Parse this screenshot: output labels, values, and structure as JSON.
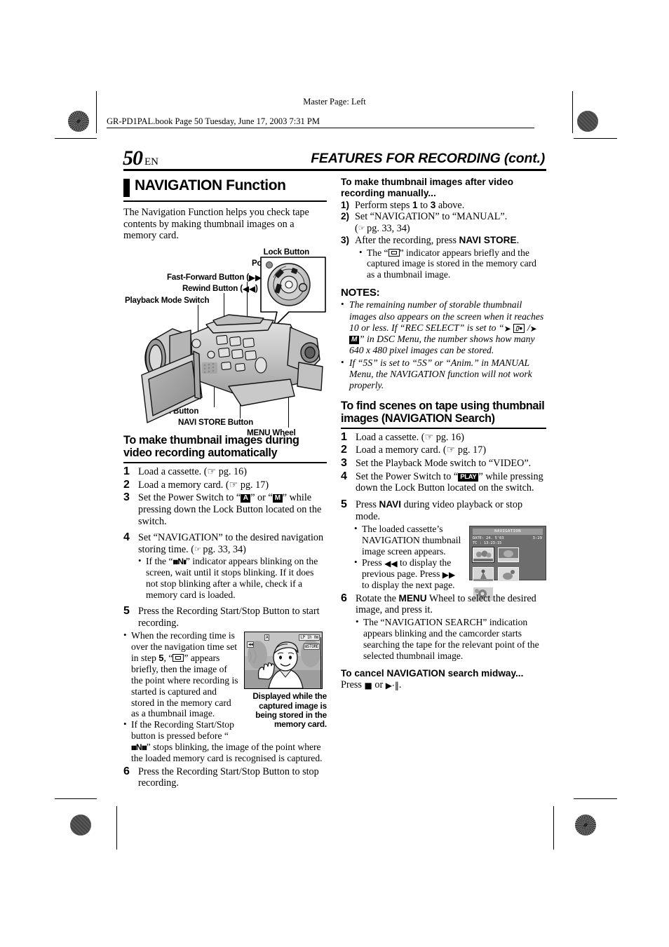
{
  "header": {
    "master_page": "Master Page: Left",
    "book_line": "GR-PD1PAL.book  Page 50  Tuesday, June 17, 2003  7:31 PM",
    "page_number": "50",
    "page_lang": "EN",
    "running_head": "FEATURES FOR RECORDING (cont.)"
  },
  "left": {
    "section_title": "NAVIGATION Function",
    "intro": "The Navigation Function helps you check tape contents by making thumbnail images on a memory card.",
    "figure_labels": {
      "lock_button": "Lock Button",
      "power_switch": "Power Switch",
      "fast_forward": "Fast-Forward Button (",
      "fast_forward_sym": "▶▶",
      "fast_forward_end": ")",
      "rewind": "Rewind Button (",
      "rewind_sym": "◀◀",
      "rewind_end": ")",
      "playback_mode": "Playback Mode Switch",
      "navi_button": "NAVI Button",
      "navi_store": "NAVI STORE Button",
      "menu_wheel": "MENU Wheel"
    },
    "subhead": "To make thumbnail images during video recording automatically",
    "steps": [
      {
        "n": "1",
        "text": "Load a cassette. (☞ pg. 16)"
      },
      {
        "n": "2",
        "text": "Load a memory card. (☞ pg. 17)"
      },
      {
        "n": "3",
        "text": "Set the Power Switch to “A” or “M” while pressing down the Lock Button located on the switch."
      },
      {
        "n": "4",
        "text": "Set “NAVIGATION” to the desired navigation storing time. (☞ pg. 33, 34)",
        "bullets": [
          "If the “NAVI” indicator appears blinking on the screen, wait until it stops blinking. If it does not stop blinking after a while, check if a memory card is loaded."
        ]
      },
      {
        "n": "5",
        "text": "Press the Recording Start/Stop Button to start recording.",
        "bullets": [
          "When the recording time is over the navigation time set in step 5, “⊞” appears briefly, then the image of the point where recording is started is captured and stored in the memory card as a thumbnail image.",
          "If the Recording Start/Stop button is pressed before “NAVI” stops blinking, the image of the point where the loaded memory card is recognised is captured."
        ]
      },
      {
        "n": "6",
        "text": "Press the Recording Start/Stop Button to stop recording."
      }
    ],
    "screen_caption": "Displayed while the captured image is being stored in the memory card.",
    "screen_osd": {
      "mode": "A",
      "battery": "◀◀",
      "rec_time": "1h 0m",
      "tape": "LP",
      "store": "STORE"
    }
  },
  "right": {
    "manual_head": "To make thumbnail images after video recording manually...",
    "manual_steps": [
      {
        "n": "1)",
        "text": "Perform steps 1 to 3 above."
      },
      {
        "n": "2)",
        "text": "Set “NAVIGATION” to “MANUAL”. (☞ pg. 33, 34)"
      },
      {
        "n": "3)",
        "text": "After the recording, press NAVI STORE.",
        "bullets": [
          "The “⊞” indicator appears briefly and the captured image is stored in the memory card as a thumbnail image."
        ]
      }
    ],
    "notes_head": "NOTES:",
    "notes": [
      "The remaining number of storable thumbnail images also appears on the screen when it reaches 10 or less. If “REC SELECT” is set to “➜ □ / ➜ M ” in DSC Menu, the number shows how many 640 x 480 pixel images can be stored.",
      "If “5S” is set to “5S” or “Anim.” in MANUAL Menu, the NAVIGATION function will not work properly."
    ],
    "search_head": "To find scenes on tape using thumbnail images (NAVIGATION Search)",
    "search_steps": [
      {
        "n": "1",
        "text": "Load a cassette. (☞ pg. 16)"
      },
      {
        "n": "2",
        "text": "Load a memory card. (☞ pg. 17)"
      },
      {
        "n": "3",
        "text": "Set the Playback Mode switch to “VIDEO”."
      },
      {
        "n": "4",
        "text": "Set the Power Switch to “PLAY” while pressing down the Lock Button located on the switch."
      },
      {
        "n": "5",
        "text": "Press NAVI during video playback or stop mode.",
        "bullets": [
          "The loaded cassette’s NAVIGATION thumbnail image screen appears.",
          "Press ◀◀ to display the previous page. Press ▶▶ to display the next page."
        ]
      },
      {
        "n": "6",
        "text": "Rotate the MENU Wheel to select the desired image, and press it.",
        "bullets": [
          "The “NAVIGATION SEARCH” indication appears blinking and the camcorder starts searching the tape for the relevant point of the selected thumbnail image."
        ]
      }
    ],
    "cancel_head": "To cancel NAVIGATION search midway...",
    "cancel_text_pre": "Press ",
    "cancel_text_mid": " or ",
    "cancel_text_post": ".",
    "cancel_stop": "■",
    "cancel_play": "▶·‖",
    "nav_screen": {
      "title": "NAVIGATION",
      "date_label": "DATE:",
      "date_value": "24. 5'03",
      "time_value": "3:29",
      "tc_label": "TC  :",
      "tc_value": "13:23:15"
    }
  }
}
